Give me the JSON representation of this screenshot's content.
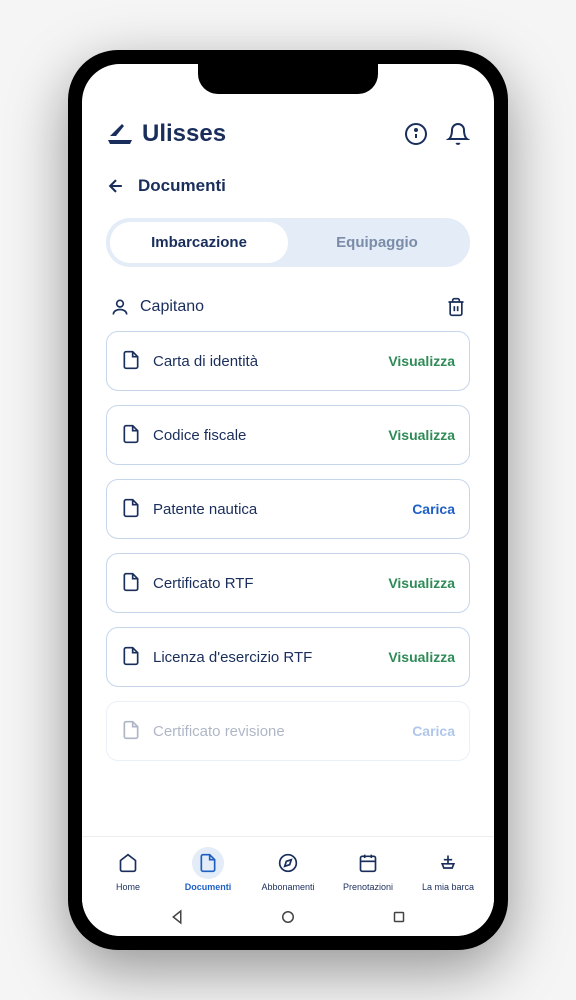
{
  "brand": "Ulisses",
  "page": {
    "title": "Documenti"
  },
  "segments": {
    "left": "Imbarcazione",
    "right": "Equipaggio"
  },
  "section": {
    "title": "Capitano"
  },
  "actions": {
    "view": "Visualizza",
    "upload": "Carica"
  },
  "docs": [
    {
      "title": "Carta di identità",
      "action": "view"
    },
    {
      "title": "Codice fiscale",
      "action": "view"
    },
    {
      "title": "Patente nautica",
      "action": "upload"
    },
    {
      "title": "Certificato RTF",
      "action": "view"
    },
    {
      "title": "Licenza d'esercizio RTF",
      "action": "view"
    },
    {
      "title": "Certificato revisione",
      "action": "upload",
      "faded": true
    }
  ],
  "nav": [
    {
      "label": "Home",
      "icon": "home",
      "active": false
    },
    {
      "label": "Documenti",
      "icon": "doc",
      "active": true
    },
    {
      "label": "Abbonamenti",
      "icon": "compass",
      "active": false
    },
    {
      "label": "Prenotazioni",
      "icon": "calendar",
      "active": false
    },
    {
      "label": "La mia barca",
      "icon": "boat",
      "active": false
    }
  ]
}
